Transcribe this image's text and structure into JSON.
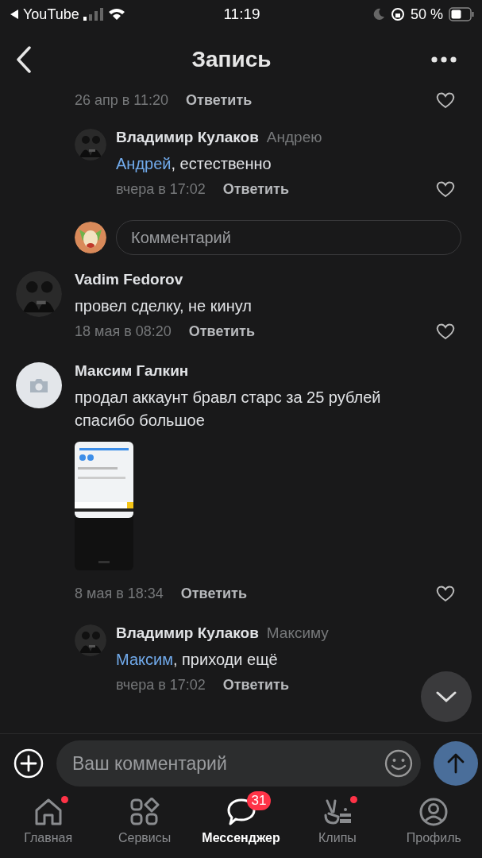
{
  "status_bar": {
    "back_app": "YouTube",
    "time": "11:19",
    "battery": "50 %"
  },
  "header": {
    "title": "Запись"
  },
  "partial_row": {
    "time": "26 апр в 11:20",
    "reply": "Ответить"
  },
  "thread": [
    {
      "kind": "reply",
      "default_avatar": false,
      "author": "Владимир Кулаков",
      "addressee": "Андрею",
      "mention": "Андрей",
      "text": ", естественно",
      "time": "вчера в 17:02",
      "reply": "Ответить"
    },
    {
      "kind": "input",
      "placeholder": "Комментарий"
    },
    {
      "kind": "comment",
      "default_avatar": false,
      "author": "Vadim Fedorov",
      "text": "провел сделку, не кинул",
      "time": "18 мая в 08:20",
      "reply": "Ответить"
    },
    {
      "kind": "comment",
      "default_avatar": true,
      "author": "Максим Галкин",
      "text": "продал аккаунт бравл старс за 25 рублей спасибо большое",
      "time": "8 мая в 18:34",
      "reply": "Ответить"
    },
    {
      "kind": "reply",
      "default_avatar": false,
      "author": "Владимир Кулаков",
      "addressee": "Максиму",
      "mention": "Максим",
      "text": ", приходи ещё",
      "time": "вчера в 17:02",
      "reply": "Ответить"
    }
  ],
  "composer": {
    "placeholder": "Ваш комментарий"
  },
  "tabs": [
    {
      "label": "Главная",
      "selected": false,
      "dot": true
    },
    {
      "label": "Сервисы",
      "selected": false,
      "dot": false
    },
    {
      "label": "Мессенджер",
      "selected": true,
      "dot": false,
      "badge": "31"
    },
    {
      "label": "Клипы",
      "selected": false,
      "dot": true
    },
    {
      "label": "Профиль",
      "selected": false,
      "dot": false
    }
  ]
}
